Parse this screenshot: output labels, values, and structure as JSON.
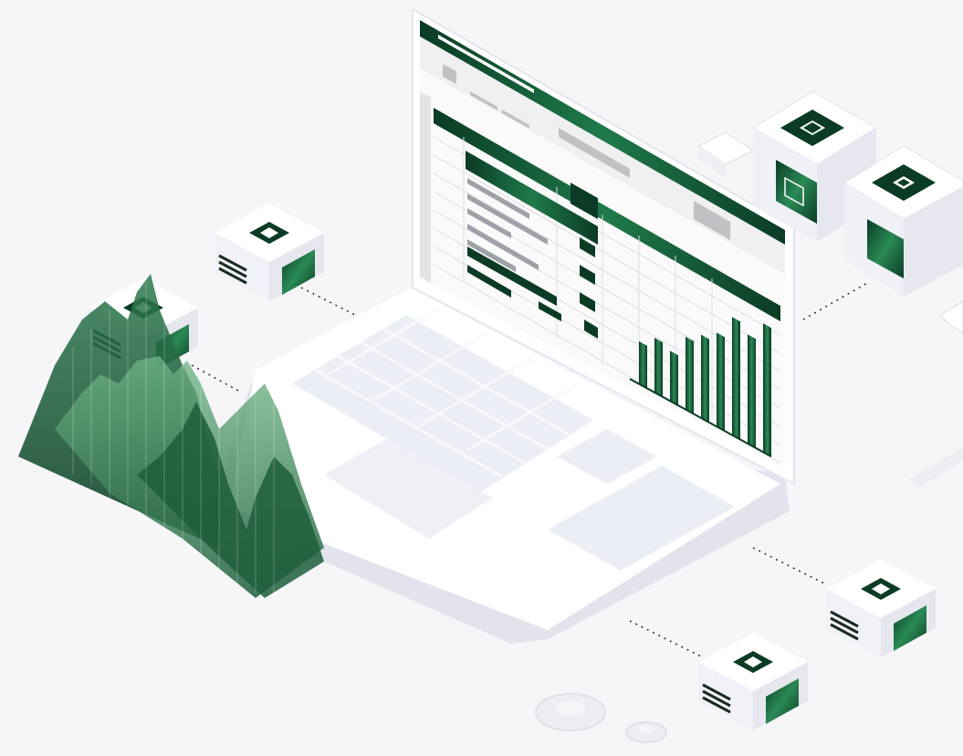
{
  "scene": {
    "description_hidden": "",
    "colors": {
      "background": "#f6f6f9",
      "device_white": "#ffffff",
      "device_shadow": "#dcdde8",
      "key_light": "#ebecf3",
      "green_dark": "#0b3b24",
      "green_mid": "#1c6b43",
      "green_light": "#4e9a66",
      "grey_bar": "#c8c9cc",
      "dotted_line": "#2a2a2a"
    },
    "icons": [
      "laptop-icon",
      "server-cube-icon",
      "gear-icon",
      "mountain-chart-icon"
    ],
    "bar_chart_levels": [
      0.28,
      0.36,
      0.33,
      0.48,
      0.55,
      0.62,
      0.78,
      0.72,
      0.85
    ]
  }
}
